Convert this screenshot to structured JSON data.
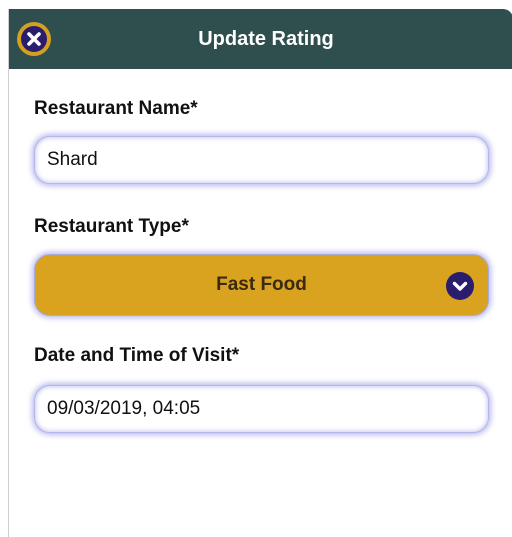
{
  "header": {
    "title": "Update Rating"
  },
  "form": {
    "restaurant_name_label": "Restaurant Name*",
    "restaurant_name_value": "Shard",
    "restaurant_type_label": "Restaurant Type*",
    "restaurant_type_value": "Fast Food",
    "visit_datetime_label": "Date and Time of Visit*",
    "visit_datetime_value": "09/03/2019, 04:05"
  },
  "icons": {
    "close": "close-circle-icon",
    "dropdown": "chevron-down-circle-icon"
  },
  "colors": {
    "header_bg": "#2f4f4f",
    "accent_gold": "#d9a21f",
    "icon_bg": "#2a1d6e",
    "field_glow": "#b9bbee"
  }
}
